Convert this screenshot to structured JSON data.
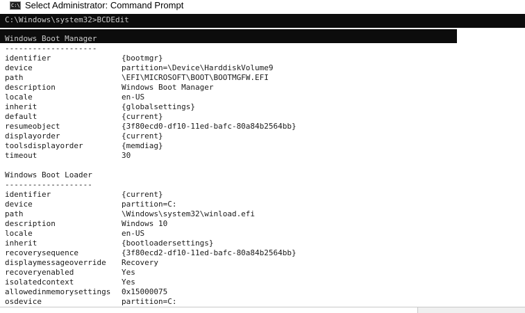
{
  "window": {
    "title": "Select Administrator: Command Prompt",
    "icon_label": "C:\\"
  },
  "console": {
    "command_line": "C:\\Windows\\system32>BCDEdit",
    "sections": [
      {
        "header": "Windows Boot Manager",
        "separator": "--------------------",
        "entries": [
          {
            "key": "identifier",
            "value": "{bootmgr}"
          },
          {
            "key": "device",
            "value": "partition=\\Device\\HarddiskVolume9"
          },
          {
            "key": "path",
            "value": "\\EFI\\MICROSOFT\\BOOT\\BOOTMGFW.EFI"
          },
          {
            "key": "description",
            "value": "Windows Boot Manager"
          },
          {
            "key": "locale",
            "value": "en-US"
          },
          {
            "key": "inherit",
            "value": "{globalsettings}"
          },
          {
            "key": "default",
            "value": "{current}"
          },
          {
            "key": "resumeobject",
            "value": "{3f80ecd0-df10-11ed-bafc-80a84b2564bb}"
          },
          {
            "key": "displayorder",
            "value": "{current}"
          },
          {
            "key": "toolsdisplayorder",
            "value": "{memdiag}"
          },
          {
            "key": "timeout",
            "value": "30"
          }
        ]
      },
      {
        "header": "Windows Boot Loader",
        "separator": "-------------------",
        "entries": [
          {
            "key": "identifier",
            "value": "{current}"
          },
          {
            "key": "device",
            "value": "partition=C:"
          },
          {
            "key": "path",
            "value": "\\Windows\\system32\\winload.efi"
          },
          {
            "key": "description",
            "value": "Windows 10"
          },
          {
            "key": "locale",
            "value": "en-US"
          },
          {
            "key": "inherit",
            "value": "{bootloadersettings}"
          },
          {
            "key": "recoverysequence",
            "value": "{3f80ecd2-df10-11ed-bafc-80a84b2564bb}"
          },
          {
            "key": "displaymessageoverride",
            "value": "Recovery"
          },
          {
            "key": "recoveryenabled",
            "value": "Yes"
          },
          {
            "key": "isolatedcontext",
            "value": "Yes"
          },
          {
            "key": "allowedinmemorysettings",
            "value": "0x15000075"
          },
          {
            "key": "osdevice",
            "value": "partition=C:"
          }
        ]
      }
    ]
  },
  "colors": {
    "console_dark_band": "#0c0c0c",
    "console_light_text": "#cccccc",
    "console_text": "#1a1a1a",
    "background": "#ffffff"
  }
}
